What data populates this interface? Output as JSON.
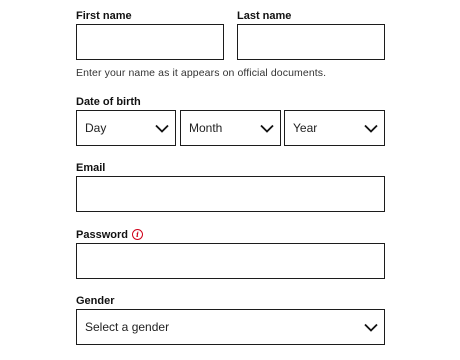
{
  "form": {
    "first_name": {
      "label": "First name",
      "value": ""
    },
    "last_name": {
      "label": "Last name",
      "value": ""
    },
    "name_hint": "Enter your name as it appears on official documents.",
    "dob": {
      "label": "Date of birth",
      "day": "Day",
      "month": "Month",
      "year": "Year"
    },
    "email": {
      "label": "Email",
      "value": ""
    },
    "password": {
      "label": "Password",
      "info_icon": "info-icon",
      "info_color": "#d0021b",
      "value": ""
    },
    "gender": {
      "label": "Gender",
      "selected": "Select a gender"
    }
  }
}
